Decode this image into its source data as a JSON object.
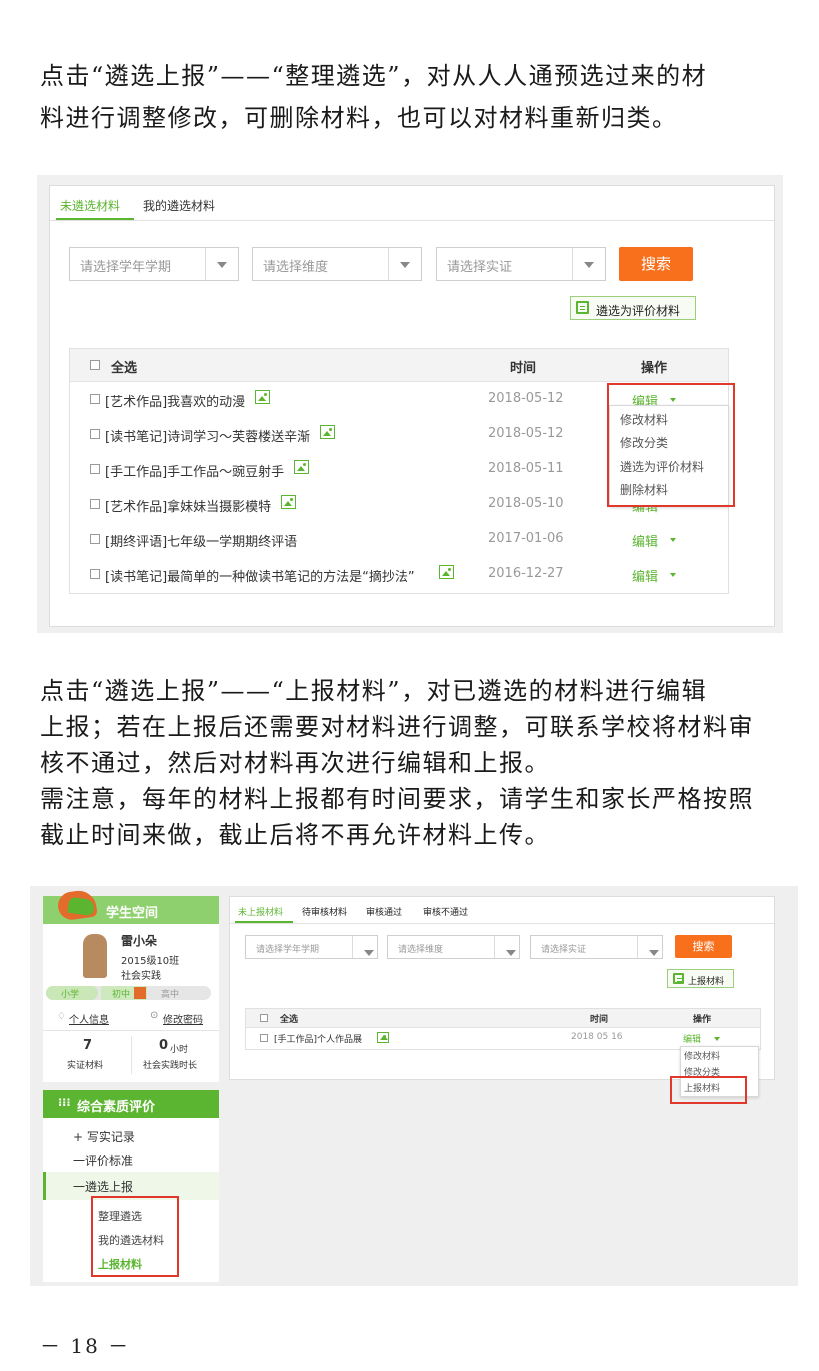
{
  "intro": {
    "line1": "点击“遴选上报”——“整理遴选”，对从人人通预选过来的材",
    "line2": "料进行调整修改，可删除材料，也可以对材料重新归类。"
  },
  "shot1": {
    "tabs": [
      "未遴选材料",
      "我的遴选材料"
    ],
    "filters": [
      "请选择学年学期",
      "请选择维度",
      "请选择实证"
    ],
    "search_label": "搜索",
    "select_for_eval_label": "遴选为评价材料",
    "table": {
      "select_all": "全选",
      "col_time": "时间",
      "col_action": "操作",
      "rows": [
        {
          "title": "[艺术作品]我喜欢的动漫",
          "date": "2018-05-12",
          "img": true
        },
        {
          "title": "[读书笔记]诗词学习～芙蓉楼送辛渐",
          "date": "2018-05-12",
          "img": true
        },
        {
          "title": "[手工作品]手工作品～豌豆射手",
          "date": "2018-05-11",
          "img": true
        },
        {
          "title": "[艺术作品]拿妹妹当摄影模特",
          "date": "2018-05-10",
          "img": true
        },
        {
          "title": "[期终评语]七年级一学期期终评语",
          "date": "2017-01-06",
          "img": false
        },
        {
          "title": "[读书笔记]最简单的一种做读书笔记的方法是“摘抄法”",
          "date": "2016-12-27",
          "img": true
        }
      ],
      "edit_label": "编辑",
      "menu": [
        "修改材料",
        "修改分类",
        "遴选为评价材料",
        "删除材料"
      ]
    }
  },
  "body2": {
    "line1": "点击“遴选上报”——“上报材料”，对已遴选的材料进行编辑",
    "line2": "上报；若在上报后还需要对材料进行调整，可联系学校将材料审",
    "line3": "核不通过，然后对材料再次进行编辑和上报。",
    "line4": "需注意，每年的材料上报都有时间要求，请学生和家长严格按照",
    "line5": "截止时间来做，截止后将不再允许材料上传。"
  },
  "shot2": {
    "sidebar": {
      "title": "学生空间",
      "name": "雷小朵",
      "class": "2015级10班",
      "category": "社会实践",
      "levels": [
        "小学",
        "初中",
        "高中"
      ],
      "personal_info": "个人信息",
      "change_password": "修改密码",
      "stat1_value": "7",
      "stat1_label": "实证材料",
      "stat2_value": "0",
      "stat2_unit": "小时",
      "stat2_label": "社会实践时长",
      "section": "综合素质评价",
      "nav": [
        "+ 写实记录",
        "一评价标准",
        "一遴选上报"
      ],
      "subnav": [
        "整理遴选",
        "我的遴选材料",
        "上报材料"
      ]
    },
    "tabs": [
      "未上报材料",
      "待审核材料",
      "审核通过",
      "审核不通过"
    ],
    "filters": [
      "请选择学年学期",
      "请选择维度",
      "请选择实证"
    ],
    "search_label": "搜索",
    "report_label": "上报材料",
    "table": {
      "select_all": "全选",
      "col_time": "时间",
      "col_action": "操作",
      "row_title": "[手工作品]个人作品展",
      "row_date": "2018 05 16",
      "edit_label": "编辑",
      "menu": [
        "修改材料",
        "修改分类",
        "上报材料"
      ]
    }
  },
  "page_number": "－ 18 －",
  "colors": {
    "accent_green": "#5cb531",
    "search_orange": "#f86f1c",
    "highlight_red": "#e0392b"
  }
}
